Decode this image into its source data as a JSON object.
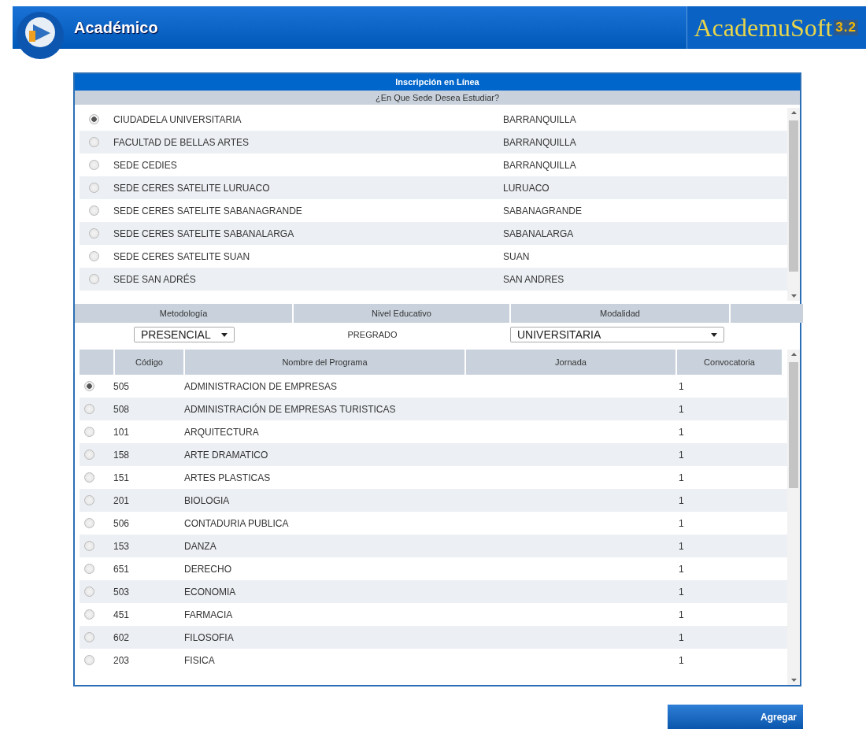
{
  "header": {
    "title": "Académico",
    "brand": "AcademuSoft",
    "version": "3.2"
  },
  "panel": {
    "title": "Inscripción en Línea",
    "question": "¿En Que Sede Desea Estudiar?"
  },
  "sedes": [
    {
      "name": "CIUDADELA UNIVERSITARIA",
      "city": "BARRANQUILLA",
      "selected": true
    },
    {
      "name": "FACULTAD DE BELLAS ARTES",
      "city": "BARRANQUILLA",
      "selected": false
    },
    {
      "name": "SEDE CEDIES",
      "city": "BARRANQUILLA",
      "selected": false
    },
    {
      "name": "SEDE CERES SATELITE LURUACO",
      "city": "LURUACO",
      "selected": false
    },
    {
      "name": "SEDE CERES SATELITE SABANAGRANDE",
      "city": "SABANAGRANDE",
      "selected": false
    },
    {
      "name": "SEDE CERES SATELITE SABANALARGA",
      "city": "SABANALARGA",
      "selected": false
    },
    {
      "name": "SEDE CERES SATELITE SUAN",
      "city": "SUAN",
      "selected": false
    },
    {
      "name": "SEDE SAN ADRÉS",
      "city": "SAN ANDRES",
      "selected": false
    }
  ],
  "filters": {
    "columns": [
      "Metodología",
      "Nivel Educativo",
      "Modalidad"
    ],
    "metodologia": "PRESENCIAL",
    "nivel": "PREGRADO",
    "modalidad": "UNIVERSITARIA"
  },
  "programs": {
    "columns": [
      "Código",
      "Nombre del Programa",
      "Jornada",
      "Convocatoria"
    ],
    "rows": [
      {
        "code": "505",
        "name": "ADMINISTRACION DE EMPRESAS",
        "convocatoria": "1",
        "selected": true
      },
      {
        "code": "508",
        "name": "ADMINISTRACIÓN DE EMPRESAS TURISTICAS",
        "convocatoria": "1",
        "selected": false
      },
      {
        "code": "101",
        "name": "ARQUITECTURA",
        "convocatoria": "1",
        "selected": false
      },
      {
        "code": "158",
        "name": "ARTE DRAMATICO",
        "convocatoria": "1",
        "selected": false
      },
      {
        "code": "151",
        "name": "ARTES PLASTICAS",
        "convocatoria": "1",
        "selected": false
      },
      {
        "code": "201",
        "name": "BIOLOGIA",
        "convocatoria": "1",
        "selected": false
      },
      {
        "code": "506",
        "name": "CONTADURIA PUBLICA",
        "convocatoria": "1",
        "selected": false
      },
      {
        "code": "153",
        "name": "DANZA",
        "convocatoria": "1",
        "selected": false
      },
      {
        "code": "651",
        "name": "DERECHO",
        "convocatoria": "1",
        "selected": false
      },
      {
        "code": "503",
        "name": "ECONOMIA",
        "convocatoria": "1",
        "selected": false
      },
      {
        "code": "451",
        "name": "FARMACIA",
        "convocatoria": "1",
        "selected": false
      },
      {
        "code": "602",
        "name": "FILOSOFIA",
        "convocatoria": "1",
        "selected": false
      },
      {
        "code": "203",
        "name": "FISICA",
        "convocatoria": "1",
        "selected": false
      }
    ]
  },
  "button": "Agregar"
}
